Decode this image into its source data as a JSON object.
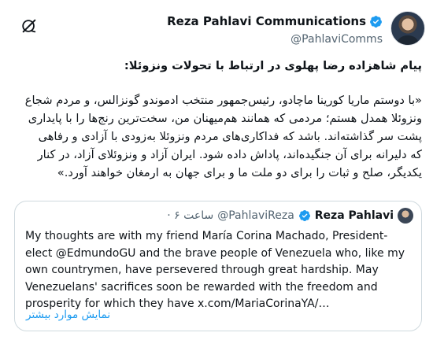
{
  "author": {
    "display_name": "Reza Pahlavi Communications",
    "handle": "@PahlaviComms"
  },
  "tweet": {
    "title": "پیام شاهزاده رضا پهلوی در ارتباط با تحولات ونزوئلا:",
    "body": "«با دوستم ماریا کورینا ماچادو، رئیس‌جمهور منتخب ادموندو گونزالس، و مردم شجاع ونزوئلا همدل هستم؛ مردمی که همانند هم‌میهنان من، سخت‌ترین رنج‌ها را با پایداری پشت سر گذاشته‌اند. باشد که فداکاری‌های مردم ونزوئلا به‌زودی با آزادی و رفاهی که دلیرانه برای آن جنگیده‌اند، پاداش داده شود. ایران آزاد و ونزوئلای آزاد، در کنار یکدیگر، صلح و ثبات را برای دو ملت ما و برای جهان به ارمغان خواهند آورد.»"
  },
  "quote": {
    "display_name": "Reza Pahlavi",
    "handle": "@PahlaviReza",
    "time": "· ساعت ۶",
    "text": "My thoughts are with my friend María Corina Machado, President-elect @EdmundoGU and the brave people of Venezuela who, like my own countrymen, have persevered through great hardship. May Venezuelans' sacrifices soon be rewarded with the freedom and prosperity for which they have x.com/MariaCorinaYA/…",
    "show_more": "نمایش موارد بیشتر"
  },
  "icons": {
    "verified": "verified-badge-icon",
    "grok": "grok-icon"
  },
  "colors": {
    "accent": "#1d9bf0",
    "secondary_text": "#536471",
    "border": "#cfd9de"
  }
}
